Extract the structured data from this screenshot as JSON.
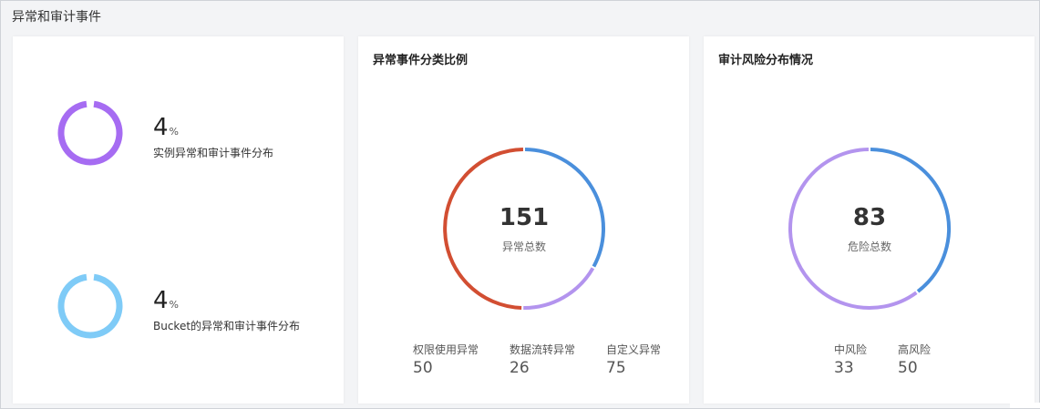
{
  "section": {
    "title": "异常和审计事件"
  },
  "ratio_card": {
    "items": [
      {
        "value": "4",
        "unit": "%",
        "desc": "实例异常和审计事件分布",
        "color": "#a66cf2",
        "percent": 4
      },
      {
        "value": "4",
        "unit": "%",
        "desc": "Bucket的异常和审计事件分布",
        "color": "#7fcbf7",
        "percent": 4
      }
    ]
  },
  "types_card": {
    "title": "异常事件分类比例",
    "total": "151",
    "total_label": "异常总数",
    "legend": [
      {
        "name": "权限使用异常",
        "value": "50",
        "color": "#4a8fdc",
        "count": 50
      },
      {
        "name": "数据流转异常",
        "value": "26",
        "color": "#b394ee",
        "count": 26
      },
      {
        "name": "自定义异常",
        "value": "75",
        "color": "#d24e32",
        "count": 75
      }
    ]
  },
  "risk_card": {
    "title": "审计风险分布情况",
    "total": "83",
    "total_label": "危险总数",
    "legend": [
      {
        "name": "中风险",
        "value": "33",
        "color": "#4a8fdc",
        "count": 33
      },
      {
        "name": "高风险",
        "value": "50",
        "color": "#b394ee",
        "count": 50
      }
    ]
  }
}
